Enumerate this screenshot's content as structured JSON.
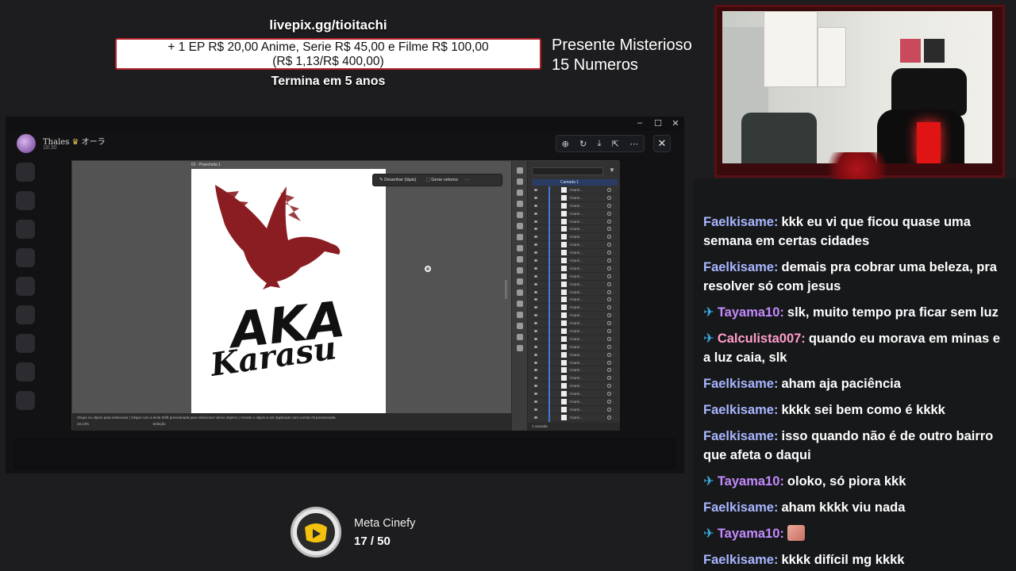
{
  "donation": {
    "url": "livepix.gg/tioitachi",
    "line1": "+ 1 EP R$ 20,00 Anime, Serie R$ 45,00 e Filme R$ 100,00",
    "line2": "(R$ 1,13/R$ 400,00)",
    "progress": 0.0028,
    "ends": "Termina em 5 anos",
    "mystery_line1": "Presente Misterioso",
    "mystery_line2": "15 Numeros"
  },
  "chat": {
    "messages": [
      {
        "user": "Faelkisame:",
        "color": "#a8b6ff",
        "badge": false,
        "text": "kkk eu vi que ficou quase uma semana em certas cidades"
      },
      {
        "user": "Faelkisame:",
        "color": "#a8b6ff",
        "badge": false,
        "text": "demais pra cobrar uma beleza, pra resolver só com jesus"
      },
      {
        "user": "Tayama10:",
        "color": "#c48bff",
        "badge": true,
        "text": "slk, muito tempo pra ficar sem luz"
      },
      {
        "user": "Calculista007:",
        "color": "#ff9ecb",
        "badge": true,
        "text": "quando eu morava em minas e a luz caia, slk"
      },
      {
        "user": "Faelkisame:",
        "color": "#a8b6ff",
        "badge": false,
        "text": "aham aja paciência"
      },
      {
        "user": "Faelkisame:",
        "color": "#a8b6ff",
        "badge": false,
        "text": "kkkk sei bem como é kkkk"
      },
      {
        "user": "Faelkisame:",
        "color": "#a8b6ff",
        "badge": false,
        "text": "isso quando não é de outro bairro que afeta o daqui"
      },
      {
        "user": "Tayama10:",
        "color": "#c48bff",
        "badge": true,
        "text": "oloko, só piora kkk"
      },
      {
        "user": "Faelkisame:",
        "color": "#a8b6ff",
        "badge": false,
        "text": "aham kkkk viu nada"
      },
      {
        "user": "Tayama10:",
        "color": "#c48bff",
        "badge": true,
        "text": "",
        "emote": "emote-icon"
      },
      {
        "user": "Faelkisame:",
        "color": "#a8b6ff",
        "badge": false,
        "text": "kkkk difícil mg kkkk"
      }
    ]
  },
  "viewer": {
    "user_name": "Thales",
    "user_tag": "オーラ",
    "time": "18:30",
    "tools": [
      "zoom-in-icon",
      "rotate-icon",
      "download-icon",
      "open-external-icon",
      "more-icon"
    ],
    "close": "✕"
  },
  "illustrator": {
    "artboard_tab": "01 - Prancheta 1",
    "toolbar": {
      "draw": "Desenhar (lápis)",
      "vectorize": "Gerar vetores"
    },
    "art": {
      "top": "AKA",
      "bottom": "Karasu",
      "bird_color": "#8a1d22"
    },
    "layers_header": "Camada 1",
    "layer_label": "<Cami...",
    "layer_count": 30,
    "status_text": "Clique no objeto para selecionar | Clique com a tecla Shift pressionada para selecionar vários objetos | Arraste o objeto a ser duplicado com a tecla Alt pressionada",
    "zoom": "33,13%",
    "status_mode": "Seleção",
    "layers_footer": "1 camada"
  },
  "meta": {
    "title": "Meta Cinefy",
    "count": "17 / 50",
    "progress": 0.34
  }
}
